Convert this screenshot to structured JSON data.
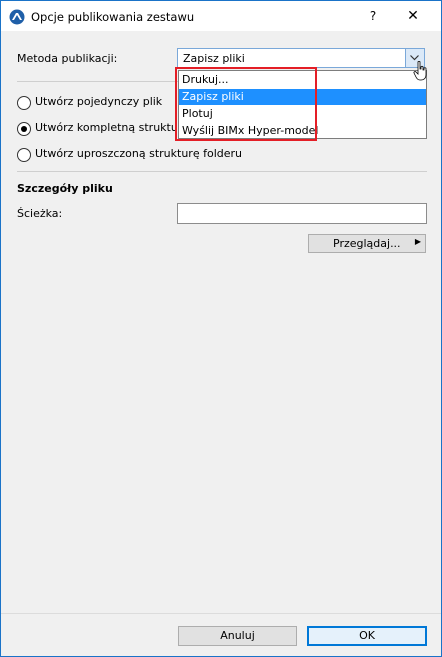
{
  "window": {
    "title": "Opcje publikowania zestawu",
    "help_label": "?",
    "close_label": "✕"
  },
  "method": {
    "label": "Metoda publikacji:",
    "value": "Zapisz pliki",
    "options": [
      "Drukuj...",
      "Zapisz pliki",
      "Plotuj",
      "Wyślij BIMx Hyper-model"
    ],
    "selected_index": 1
  },
  "structure": {
    "options": [
      "Utwórz pojedynczy plik",
      "Utwórz kompletną strukturę",
      "Utwórz uproszczoną strukturę folderu"
    ],
    "selected_index": 1
  },
  "file_details": {
    "heading": "Szczegóły pliku",
    "path_label": "Ścieżka:",
    "path_value": "",
    "browse_label": "Przeglądaj..."
  },
  "footer": {
    "cancel_label": "Anuluj",
    "ok_label": "OK"
  },
  "colors": {
    "accent": "#0078d7",
    "selection": "#1e90ff",
    "highlight_frame": "#e41e26"
  }
}
